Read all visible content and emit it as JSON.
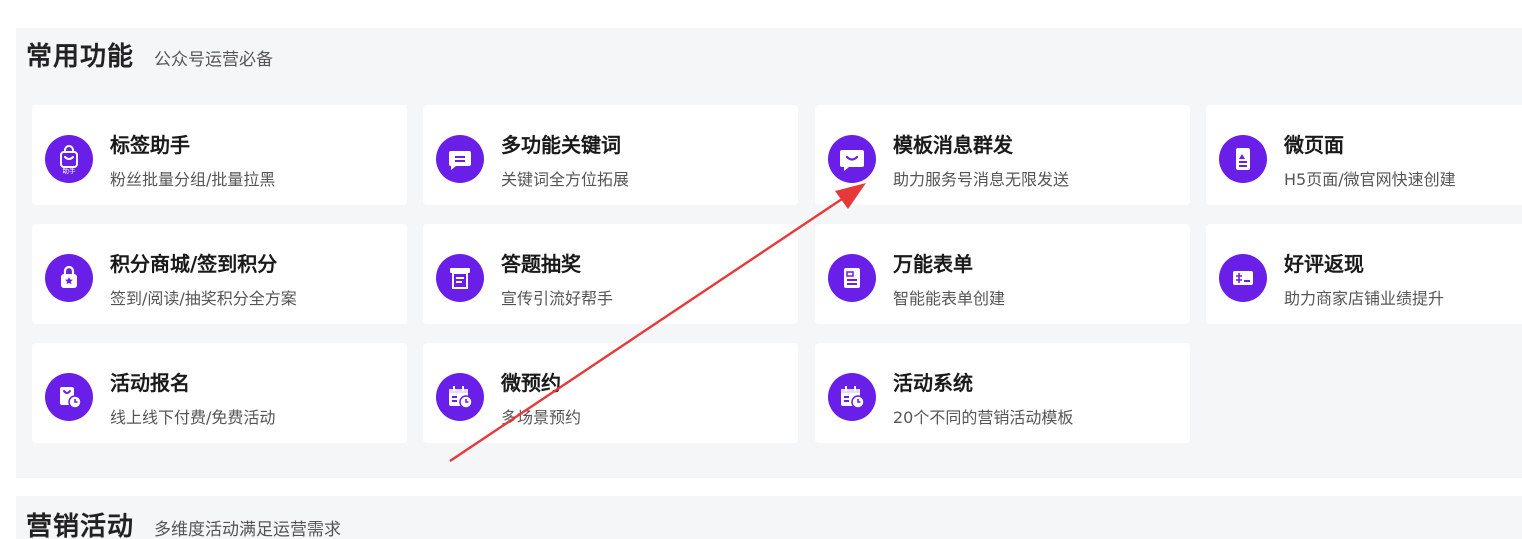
{
  "sections": [
    {
      "title": "常用功能",
      "subtitle": "公众号运营必备"
    },
    {
      "title": "营销活动",
      "subtitle": "多维度活动满足运营需求"
    }
  ],
  "cards": [
    {
      "title": "标签助手",
      "desc": "粉丝批量分组/批量拉黑",
      "icon": "tag-helper-bag-icon",
      "icon_text": "助手"
    },
    {
      "title": "多功能关键词",
      "desc": "关键词全方位拓展",
      "icon": "keyword-chat-icon"
    },
    {
      "title": "模板消息群发",
      "desc": "助力服务号消息无限发送",
      "icon": "template-message-icon"
    },
    {
      "title": "微页面",
      "desc": "H5页面/微官网快速创建",
      "icon": "micro-page-icon"
    },
    {
      "title": "积分商城/签到积分",
      "desc": "签到/阅读/抽奖积分全方案",
      "icon": "points-mall-bag-icon"
    },
    {
      "title": "答题抽奖",
      "desc": "宣传引流好帮手",
      "icon": "quiz-lottery-icon"
    },
    {
      "title": "万能表单",
      "desc": "智能能表单创建",
      "icon": "form-icon"
    },
    {
      "title": "好评返现",
      "desc": "助力商家店铺业绩提升",
      "icon": "review-cashback-card-icon"
    },
    {
      "title": "活动报名",
      "desc": "线上线下付费/免费活动",
      "icon": "event-signup-icon"
    },
    {
      "title": "微预约",
      "desc": "多场景预约",
      "icon": "calendar-clock-icon"
    },
    {
      "title": "活动系统",
      "desc": "20个不同的营销活动模板",
      "icon": "calendar-clock-icon"
    }
  ],
  "colors": {
    "accent": "#6a1fe8",
    "panel_bg": "#f5f6f7",
    "annotation_arrow": "#e8393a"
  }
}
